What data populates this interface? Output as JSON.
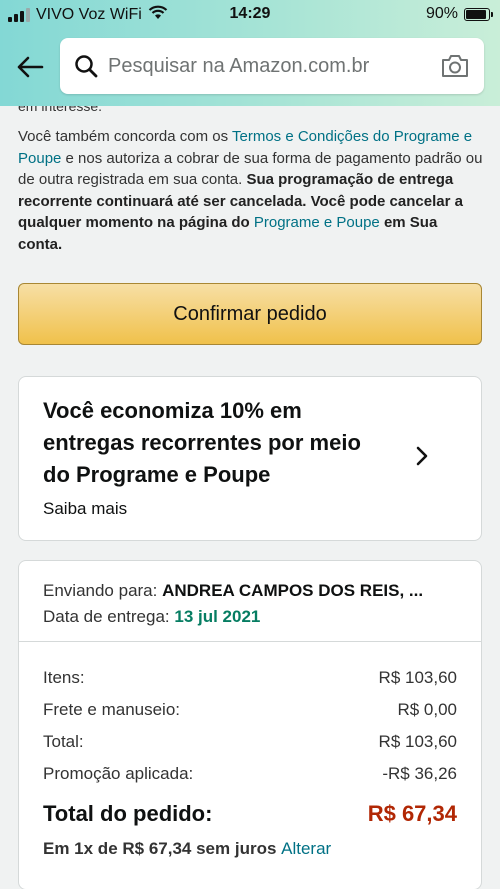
{
  "status_bar": {
    "carrier": "VIVO Voz WiFi",
    "time": "14:29",
    "battery": "90%",
    "battery_level": 0.9
  },
  "search": {
    "placeholder": "Pesquisar na Amazon.com.br"
  },
  "legal": {
    "cut_line": "em interesse.",
    "p1": "Você também concorda com os ",
    "terms_link": "Termos e Condições do Programe e Poupe",
    "p2": " e nos autoriza a cobrar de sua forma de pagamento padrão ou de outra registrada em sua conta. ",
    "bold1": "Sua programação de entrega recorrente continuará até ser cancelada. Você pode cancelar a qualquer momento na página do ",
    "program_link": "Programe e Poupe",
    "bold2": " em Sua conta."
  },
  "confirm_button": "Confirmar pedido",
  "promo": {
    "title": "Você economiza 10% em entregas recorrentes por meio do Programe e Poupe",
    "link": "Saiba mais"
  },
  "shipping": {
    "to_label": "Enviando para: ",
    "to_name": "ANDREA CAMPOS DOS REIS, ...",
    "date_label": "Data de entrega: ",
    "date_value": "13 jul 2021"
  },
  "summary": {
    "rows": [
      {
        "label": "Itens:",
        "value": "R$ 103,60"
      },
      {
        "label": "Frete e manuseio:",
        "value": "R$ 0,00"
      },
      {
        "label": "Total:",
        "value": "R$ 103,60"
      },
      {
        "label": "Promoção aplicada:",
        "value": "-R$ 36,26"
      }
    ],
    "total_label": "Total do pedido:",
    "total_value": "R$ 67,34",
    "installment_text": "Em 1x de R$ 67,34 sem juros ",
    "installment_link": "Alterar"
  },
  "colors": {
    "link": "#007185",
    "price": "#b12704",
    "delivery_date": "#067d62",
    "button": "#f0c14b"
  }
}
